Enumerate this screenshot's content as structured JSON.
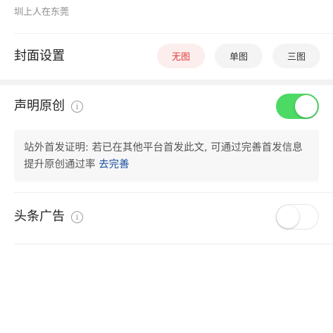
{
  "header": {
    "top_text": "圳上人在东莞"
  },
  "cover": {
    "title": "封面设置",
    "options": [
      {
        "label": "无图",
        "active": true
      },
      {
        "label": "单图",
        "active": false
      },
      {
        "label": "三图",
        "active": false
      }
    ]
  },
  "original": {
    "title": "声明原创",
    "info_icon": "info-icon",
    "toggle_on": true,
    "notice_text": "站外首发证明: 若已在其他平台首发此文, 可通过完善首发信息提升原创通过率",
    "notice_link": "去完善"
  },
  "ads": {
    "title": "头条广告",
    "info_icon": "info-icon",
    "toggle_on": false
  },
  "colors": {
    "accent_red": "#e03c3c",
    "toggle_green": "#4cd964",
    "link_blue": "#1a4fa0"
  }
}
